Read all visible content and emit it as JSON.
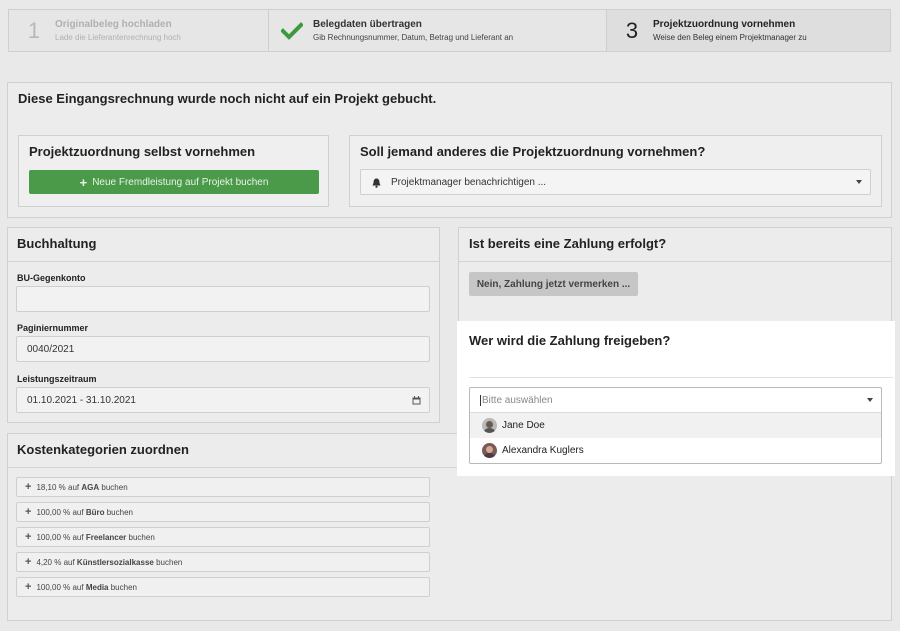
{
  "steps": [
    {
      "number": "1",
      "title": "Originalbeleg hochladen",
      "subtitle": "Lade die Lieferantenrechnung hoch"
    },
    {
      "icon": "check-icon",
      "title": "Belegdaten übertragen",
      "subtitle": "Gib Rechnungsnummer, Datum, Betrag und Lieferant an"
    },
    {
      "number": "3",
      "title": "Projektzuordnung vornehmen",
      "subtitle": "Weise den Beleg einem Projektmanager zu"
    }
  ],
  "notice": {
    "title": "Diese Eingangsrechnung wurde noch nicht auf ein Projekt gebucht."
  },
  "self_assign": {
    "title": "Projektzuordnung selbst vornehmen",
    "button_label": "Neue Fremdleistung auf Projekt buchen"
  },
  "other_assign": {
    "title": "Soll jemand anderes die Projektzuordnung vornehmen?",
    "select_value": "Projektmanager benachrichtigen ..."
  },
  "accounting": {
    "title": "Buchhaltung",
    "account_label": "BU-Gegenkonto",
    "account_value": "",
    "page_label": "Paginiernummer",
    "page_value": "0040/2021",
    "period_label": "Leistungszeitraum",
    "period_value": "01.10.2021 - 31.10.2021"
  },
  "payment": {
    "title": "Ist bereits eine Zahlung erfolgt?",
    "button_label": "Nein, Zahlung jetzt vermerken ..."
  },
  "approval": {
    "title": "Wer wird die Zahlung freigeben?",
    "placeholder": "Bitte auswählen",
    "options": [
      {
        "name": "Jane Doe"
      },
      {
        "name": "Alexandra Kuglers"
      }
    ]
  },
  "categories": {
    "title": "Kostenkategorien zuordnen",
    "items": [
      {
        "pct": "18,10 % auf",
        "name": "AGA",
        "suffix": "buchen"
      },
      {
        "pct": "100,00 % auf",
        "name": "Büro",
        "suffix": "buchen"
      },
      {
        "pct": "100,00 % auf",
        "name": "Freelancer",
        "suffix": "buchen"
      },
      {
        "pct": "4,20 % auf",
        "name": "Künstlersozialkasse",
        "suffix": "buchen"
      },
      {
        "pct": "100,00 % auf",
        "name": "Media",
        "suffix": "buchen"
      }
    ]
  },
  "colors": {
    "accent_green": "#4a9a4a",
    "check_green": "#3c9a3c"
  }
}
